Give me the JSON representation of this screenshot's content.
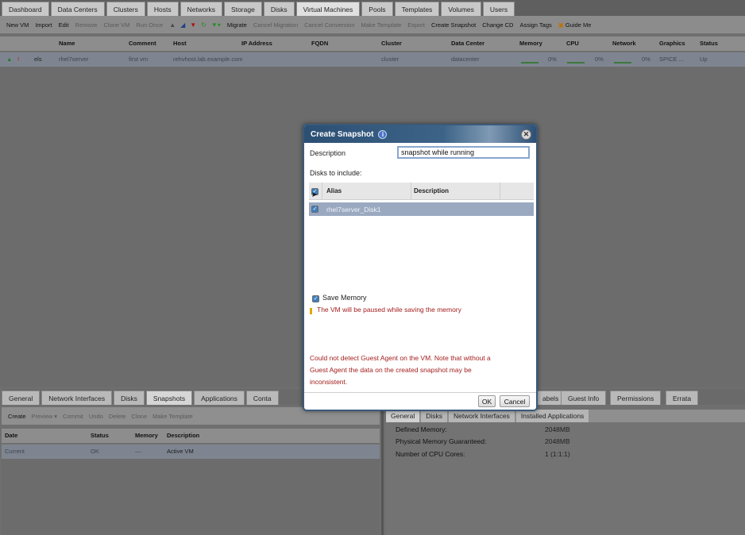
{
  "top_tabs": [
    "Dashboard",
    "Data Centers",
    "Clusters",
    "Hosts",
    "Networks",
    "Storage",
    "Disks",
    "Virtual Machines",
    "Pools",
    "Templates",
    "Volumes",
    "Users"
  ],
  "toolbar": {
    "new_vm": "New VM",
    "import": "Import",
    "edit": "Edit",
    "remove": "Remove",
    "clone_vm": "Clone VM",
    "run_once": "Run Once",
    "migrate": "Migrate",
    "cancel_migration": "Cancel Migration",
    "cancel_conversion": "Cancel Conversion",
    "make_template": "Make Template",
    "export": "Export",
    "create_snapshot": "Create Snapshot",
    "change_cd": "Change CD",
    "assign_tags": "Assign Tags",
    "guide_me": "Guide Me"
  },
  "vm_table": {
    "headers": {
      "name": "Name",
      "comment": "Comment",
      "host": "Host",
      "ip": "IP Address",
      "fqdn": "FQDN",
      "cluster": "Cluster",
      "datacenter": "Data Center",
      "memory": "Memory",
      "cpu": "CPU",
      "network": "Network",
      "graphics": "Graphics",
      "status": "Status"
    },
    "row": {
      "tag": "els",
      "name": "rhel7server",
      "comment": "first vm",
      "host": "rehvhost.lab.example.com",
      "cluster": "cluster",
      "datacenter": "datacenter",
      "memory": "0%",
      "cpu": "0%",
      "network": "0%",
      "graphics": "SPICE ...",
      "status": "Up"
    }
  },
  "bottom_left": {
    "tabs": [
      "General",
      "Network Interfaces",
      "Disks",
      "Snapshots",
      "Applications",
      "Conta"
    ],
    "toolbar": [
      "Create",
      "Preview ▾",
      "Commit",
      "Undo",
      "Delete",
      "Clone",
      "Make Template"
    ],
    "headers": {
      "date": "Date",
      "status": "Status",
      "memory": "Memory",
      "description": "Description"
    },
    "row": {
      "date": "Current",
      "status": "OK",
      "memory": "—",
      "description": "Active VM"
    }
  },
  "bottom_right": {
    "tabs": [
      "abels",
      "Guest Info",
      "Permissions",
      "Errata"
    ],
    "sub_tabs": [
      "General",
      "Disks",
      "Network Interfaces",
      "Installed Applications"
    ],
    "info": [
      {
        "label": "Defined Memory:",
        "value": "2048MB"
      },
      {
        "label": "Physical Memory Guaranteed:",
        "value": "2048MB"
      },
      {
        "label": "Number of CPU Cores:",
        "value": "1 (1:1:1)"
      }
    ]
  },
  "dialog": {
    "title": "Create Snapshot",
    "description_label": "Description",
    "description_value": "snapshot while running",
    "disks_label": "Disks to include:",
    "disk_headers": {
      "alias": "Alias",
      "description": "Description"
    },
    "disk_row": {
      "alias": "rhel7server_Disk1"
    },
    "save_memory_label": "Save Memory",
    "memory_warning": "The VM will be paused while saving the memory",
    "agent_warning_1": "Could not detect Guest Agent on the VM. Note that without a",
    "agent_warning_2": "Guest Agent the data on the created snapshot may be",
    "agent_warning_3": "inconsistent.",
    "ok_label": "OK",
    "cancel_label": "Cancel"
  }
}
